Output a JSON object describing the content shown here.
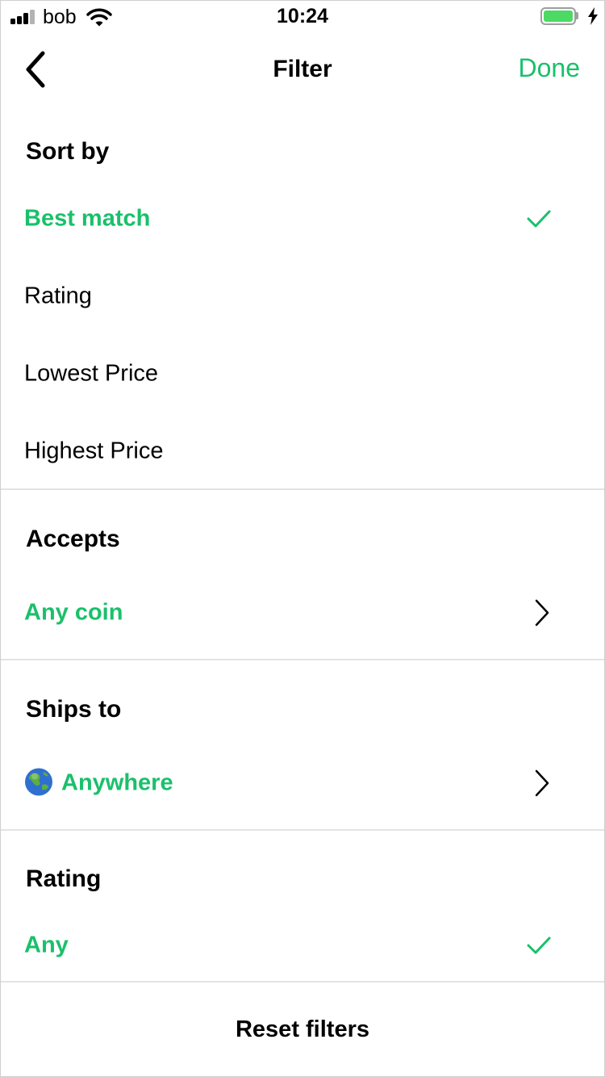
{
  "status_bar": {
    "carrier": "bob",
    "time": "10:24",
    "battery_level": 1.0
  },
  "nav": {
    "title": "Filter",
    "done_label": "Done"
  },
  "sort_by": {
    "title": "Sort by",
    "options": [
      {
        "label": "Best match",
        "selected": true
      },
      {
        "label": "Rating",
        "selected": false
      },
      {
        "label": "Lowest Price",
        "selected": false
      },
      {
        "label": "Highest Price",
        "selected": false
      }
    ]
  },
  "accepts": {
    "title": "Accepts",
    "value": "Any coin"
  },
  "ships_to": {
    "title": "Ships to",
    "value": "Anywhere",
    "icon": "globe-icon"
  },
  "rating": {
    "title": "Rating",
    "value": "Any"
  },
  "reset_label": "Reset filters",
  "colors": {
    "accent": "#1ac06b",
    "divider": "#e3e3e3",
    "battery": "#4cd964"
  }
}
